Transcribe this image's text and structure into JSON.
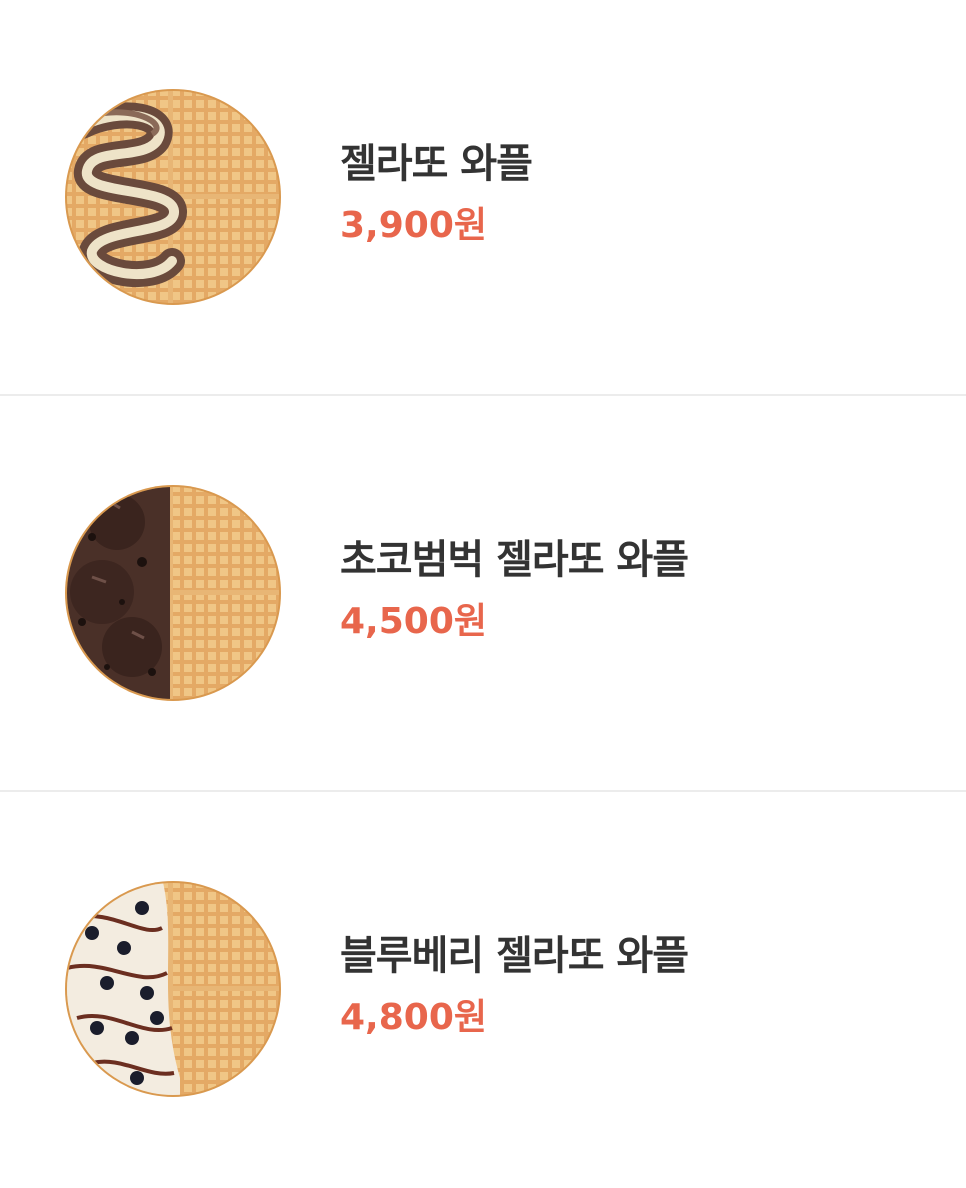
{
  "menu": {
    "items": [
      {
        "name": "젤라또 와플",
        "price": "3,900원",
        "image_icon": "gelato-waffle-icon"
      },
      {
        "name": "초코범벅 젤라또 와플",
        "price": "4,500원",
        "image_icon": "choco-gelato-waffle-icon"
      },
      {
        "name": "블루베리 젤라또 와플",
        "price": "4,800원",
        "image_icon": "blueberry-gelato-waffle-icon"
      }
    ]
  },
  "colors": {
    "price": "#e8664c",
    "name": "#333333",
    "divider": "#ececec",
    "waffle": "#e9b56e"
  }
}
